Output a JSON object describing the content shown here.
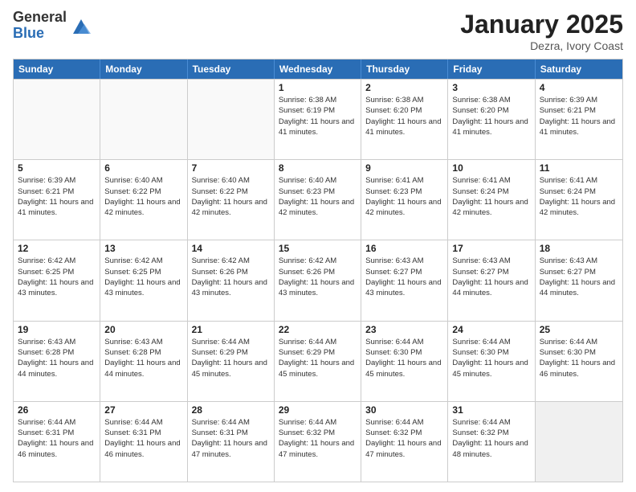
{
  "logo": {
    "general": "General",
    "blue": "Blue"
  },
  "title": "January 2025",
  "subtitle": "Dezra, Ivory Coast",
  "weekdays": [
    "Sunday",
    "Monday",
    "Tuesday",
    "Wednesday",
    "Thursday",
    "Friday",
    "Saturday"
  ],
  "weeks": [
    [
      {
        "day": "",
        "info": ""
      },
      {
        "day": "",
        "info": ""
      },
      {
        "day": "",
        "info": ""
      },
      {
        "day": "1",
        "info": "Sunrise: 6:38 AM\nSunset: 6:19 PM\nDaylight: 11 hours and 41 minutes."
      },
      {
        "day": "2",
        "info": "Sunrise: 6:38 AM\nSunset: 6:20 PM\nDaylight: 11 hours and 41 minutes."
      },
      {
        "day": "3",
        "info": "Sunrise: 6:38 AM\nSunset: 6:20 PM\nDaylight: 11 hours and 41 minutes."
      },
      {
        "day": "4",
        "info": "Sunrise: 6:39 AM\nSunset: 6:21 PM\nDaylight: 11 hours and 41 minutes."
      }
    ],
    [
      {
        "day": "5",
        "info": "Sunrise: 6:39 AM\nSunset: 6:21 PM\nDaylight: 11 hours and 41 minutes."
      },
      {
        "day": "6",
        "info": "Sunrise: 6:40 AM\nSunset: 6:22 PM\nDaylight: 11 hours and 42 minutes."
      },
      {
        "day": "7",
        "info": "Sunrise: 6:40 AM\nSunset: 6:22 PM\nDaylight: 11 hours and 42 minutes."
      },
      {
        "day": "8",
        "info": "Sunrise: 6:40 AM\nSunset: 6:23 PM\nDaylight: 11 hours and 42 minutes."
      },
      {
        "day": "9",
        "info": "Sunrise: 6:41 AM\nSunset: 6:23 PM\nDaylight: 11 hours and 42 minutes."
      },
      {
        "day": "10",
        "info": "Sunrise: 6:41 AM\nSunset: 6:24 PM\nDaylight: 11 hours and 42 minutes."
      },
      {
        "day": "11",
        "info": "Sunrise: 6:41 AM\nSunset: 6:24 PM\nDaylight: 11 hours and 42 minutes."
      }
    ],
    [
      {
        "day": "12",
        "info": "Sunrise: 6:42 AM\nSunset: 6:25 PM\nDaylight: 11 hours and 43 minutes."
      },
      {
        "day": "13",
        "info": "Sunrise: 6:42 AM\nSunset: 6:25 PM\nDaylight: 11 hours and 43 minutes."
      },
      {
        "day": "14",
        "info": "Sunrise: 6:42 AM\nSunset: 6:26 PM\nDaylight: 11 hours and 43 minutes."
      },
      {
        "day": "15",
        "info": "Sunrise: 6:42 AM\nSunset: 6:26 PM\nDaylight: 11 hours and 43 minutes."
      },
      {
        "day": "16",
        "info": "Sunrise: 6:43 AM\nSunset: 6:27 PM\nDaylight: 11 hours and 43 minutes."
      },
      {
        "day": "17",
        "info": "Sunrise: 6:43 AM\nSunset: 6:27 PM\nDaylight: 11 hours and 44 minutes."
      },
      {
        "day": "18",
        "info": "Sunrise: 6:43 AM\nSunset: 6:27 PM\nDaylight: 11 hours and 44 minutes."
      }
    ],
    [
      {
        "day": "19",
        "info": "Sunrise: 6:43 AM\nSunset: 6:28 PM\nDaylight: 11 hours and 44 minutes."
      },
      {
        "day": "20",
        "info": "Sunrise: 6:43 AM\nSunset: 6:28 PM\nDaylight: 11 hours and 44 minutes."
      },
      {
        "day": "21",
        "info": "Sunrise: 6:44 AM\nSunset: 6:29 PM\nDaylight: 11 hours and 45 minutes."
      },
      {
        "day": "22",
        "info": "Sunrise: 6:44 AM\nSunset: 6:29 PM\nDaylight: 11 hours and 45 minutes."
      },
      {
        "day": "23",
        "info": "Sunrise: 6:44 AM\nSunset: 6:30 PM\nDaylight: 11 hours and 45 minutes."
      },
      {
        "day": "24",
        "info": "Sunrise: 6:44 AM\nSunset: 6:30 PM\nDaylight: 11 hours and 45 minutes."
      },
      {
        "day": "25",
        "info": "Sunrise: 6:44 AM\nSunset: 6:30 PM\nDaylight: 11 hours and 46 minutes."
      }
    ],
    [
      {
        "day": "26",
        "info": "Sunrise: 6:44 AM\nSunset: 6:31 PM\nDaylight: 11 hours and 46 minutes."
      },
      {
        "day": "27",
        "info": "Sunrise: 6:44 AM\nSunset: 6:31 PM\nDaylight: 11 hours and 46 minutes."
      },
      {
        "day": "28",
        "info": "Sunrise: 6:44 AM\nSunset: 6:31 PM\nDaylight: 11 hours and 47 minutes."
      },
      {
        "day": "29",
        "info": "Sunrise: 6:44 AM\nSunset: 6:32 PM\nDaylight: 11 hours and 47 minutes."
      },
      {
        "day": "30",
        "info": "Sunrise: 6:44 AM\nSunset: 6:32 PM\nDaylight: 11 hours and 47 minutes."
      },
      {
        "day": "31",
        "info": "Sunrise: 6:44 AM\nSunset: 6:32 PM\nDaylight: 11 hours and 48 minutes."
      },
      {
        "day": "",
        "info": ""
      }
    ]
  ]
}
